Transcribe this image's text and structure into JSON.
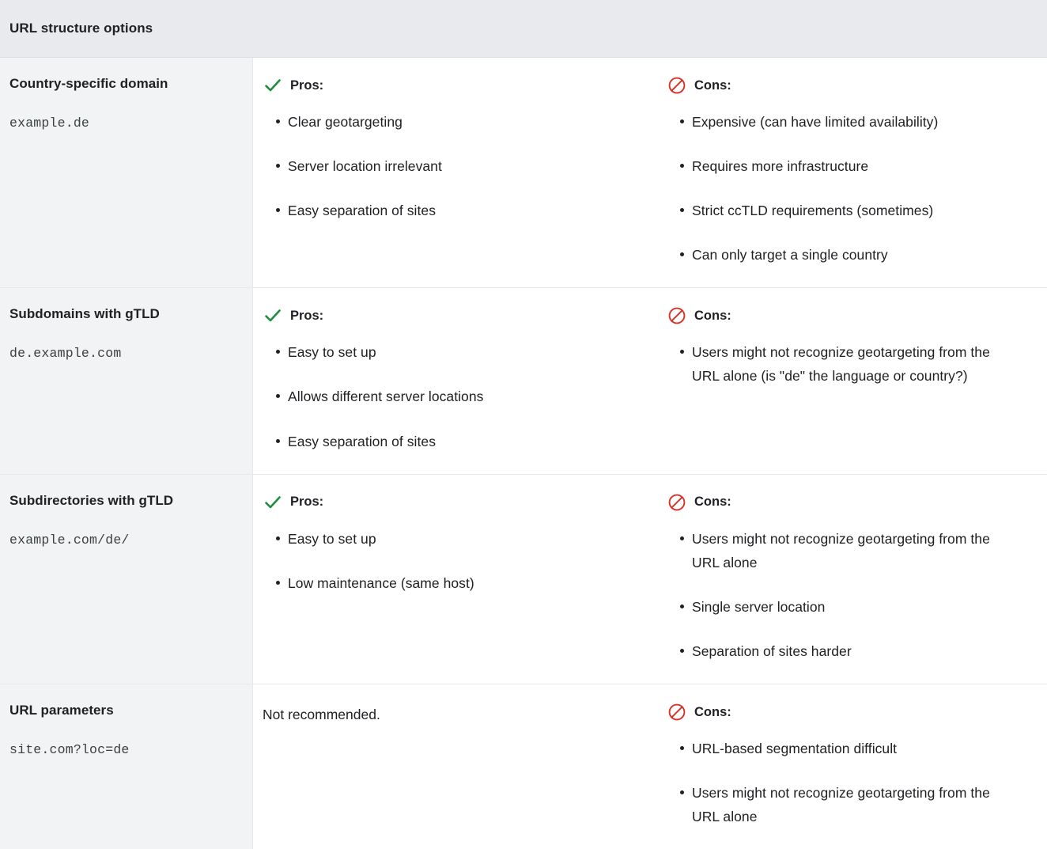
{
  "header": {
    "title": "URL structure options"
  },
  "labels": {
    "pros": "Pros:",
    "cons": "Cons:",
    "check_icon": "check-icon",
    "prohibition_icon": "prohibition-icon"
  },
  "colors": {
    "header_bg": "#e8eaed",
    "option_cell_bg": "#f1f3f4",
    "content_bg": "#ffffff",
    "border": "#e6e8eb",
    "text": "#202124",
    "code_text": "#3c4043",
    "pros_green": "#1e8e3e",
    "cons_red": "#d93025"
  },
  "rows": [
    {
      "title": "Country-specific domain",
      "code": "example.de",
      "pros_label": "Pros:",
      "pros": [
        "Clear geotargeting",
        "Server location irrelevant",
        "Easy separation of sites"
      ],
      "cons_label": "Cons:",
      "cons": [
        "Expensive (can have limited availability)",
        "Requires more infrastructure",
        "Strict ccTLD requirements (sometimes)",
        "Can only target a single country"
      ]
    },
    {
      "title": "Subdomains with gTLD",
      "code": "de.example.com",
      "pros_label": "Pros:",
      "pros": [
        "Easy to set up",
        "Allows different server locations",
        "Easy separation of sites"
      ],
      "cons_label": "Cons:",
      "cons": [
        "Users might not recognize geotargeting from the URL alone (is \"de\" the language or country?)"
      ]
    },
    {
      "title": "Subdirectories with gTLD",
      "code": "example.com/de/",
      "pros_label": "Pros:",
      "pros": [
        "Easy to set up",
        "Low maintenance (same host)"
      ],
      "cons_label": "Cons:",
      "cons": [
        "Users might not recognize geotargeting from the URL alone",
        "Single server location",
        "Separation of sites harder"
      ]
    },
    {
      "title": "URL parameters",
      "code": "site.com?loc=de",
      "pros_note": "Not recommended.",
      "cons_label": "Cons:",
      "cons": [
        "URL-based segmentation difficult",
        "Users might not recognize geotargeting from the URL alone"
      ]
    }
  ]
}
